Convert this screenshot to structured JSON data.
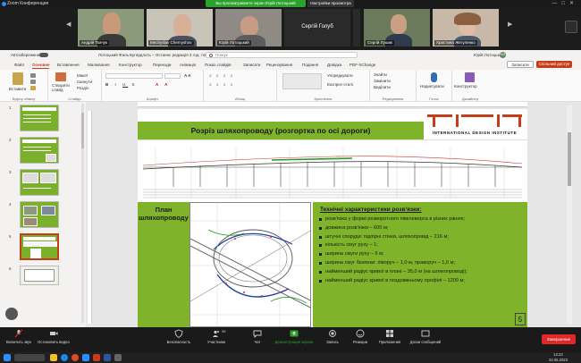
{
  "zoom": {
    "window_title": "Zoom Конференция",
    "share_banner": "Вы просматриваете экран Юрій Лотоцький",
    "share_options": "Настройки просмотра"
  },
  "participants": [
    {
      "name": "Андрій Ткачук"
    },
    {
      "name": "Mechyslav Chernyshov"
    },
    {
      "name": "Юрій Лотоцький"
    },
    {
      "name": "Сергій Голуб"
    },
    {
      "name": "Сергій Голуб"
    },
    {
      "name": "Сергій Лушик"
    },
    {
      "name": "Христина Жегуленко"
    }
  ],
  "ppt": {
    "autosave_label": "Автозбереження",
    "doc_title": "Лотоцький Фаль Бугердлоть – Останнє редакція 3 год. тому",
    "search_placeholder": "Пошук",
    "user": "Юрій Лотоцький",
    "avatar_initials": "ЮЛ",
    "menu": [
      "Файл",
      "Основне",
      "Вставлення",
      "Малювання",
      "Конструктор",
      "Переходи",
      "Анімація",
      "Показ слайдів",
      "Записати",
      "Рецензування",
      "Подання",
      "Довідка",
      "PDF-XChange"
    ],
    "active_menu": "Основне",
    "notes_button": "Записати",
    "share_button": "Спільний доступ",
    "ribbon": {
      "paste": "Вставити",
      "new_slide": "Створити слайд",
      "layout": "Макет",
      "reset": "Скинути",
      "section": "Розділ",
      "groups": [
        "Буфер обміну",
        "Слайди",
        "Шрифт",
        "Абзац",
        "Креслення",
        "Редагування",
        "Голос",
        "Дизайнер"
      ],
      "arrange": "Упорядкувати",
      "quick_styles": "Експрес-стилі",
      "find": "Знайти",
      "replace": "Замінити",
      "select": "Виділити",
      "dictate": "Надиктувати",
      "designer": "Конструктор"
    }
  },
  "thumb_numbers": [
    "1",
    "2",
    "3",
    "4",
    "5",
    "6"
  ],
  "slide": {
    "logo_text": "INTERNATIONAL DESIGN INSTITUTE",
    "heading": "Розріз шляхопроводу (розгортка по осі дороги)",
    "plan_title_1": "План",
    "plan_title_2": "шляхопроводу",
    "tech_title": "Технічні характеристики розв'язки:",
    "tech_items": [
      "розв'язка у формі розворотного півклеверса в різних рівнях;",
      "довжина розв'язки – 600 м;",
      "штучні споруди: підпірні стінки, шляхопровід – 216 м;",
      "кількість смуг руху – 1;",
      "ширина смуги руху – 6 м;",
      "ширина смуг безпеки: ліворуч – 1,0 м, праворуч – 1,0 м;",
      "найменший радіус кривої в плані – 35,0 м (на шляхопроводі);",
      "найменший радіус кривої в поздовжньому профілі – 1200 м;"
    ],
    "number": "5"
  },
  "zoom_controls": {
    "mic": "Включить звук",
    "video": "Остановить видео",
    "security": "Безопасность",
    "participants": "Участники",
    "participants_count": "39",
    "chat": "Чат",
    "share": "Демонстрация экрана",
    "record": "Запись",
    "reactions": "Реакции",
    "apps": "Приложения",
    "whiteboards": "Доски сообщений",
    "leave": "Завершение"
  },
  "taskbar": {
    "time": "12:23",
    "date": "24.05.2023"
  },
  "colors": {
    "slide_green": "#7fb32a",
    "accent": "#c43e1c",
    "zoom_green": "#2ca12c",
    "leave_red": "#e02828"
  }
}
